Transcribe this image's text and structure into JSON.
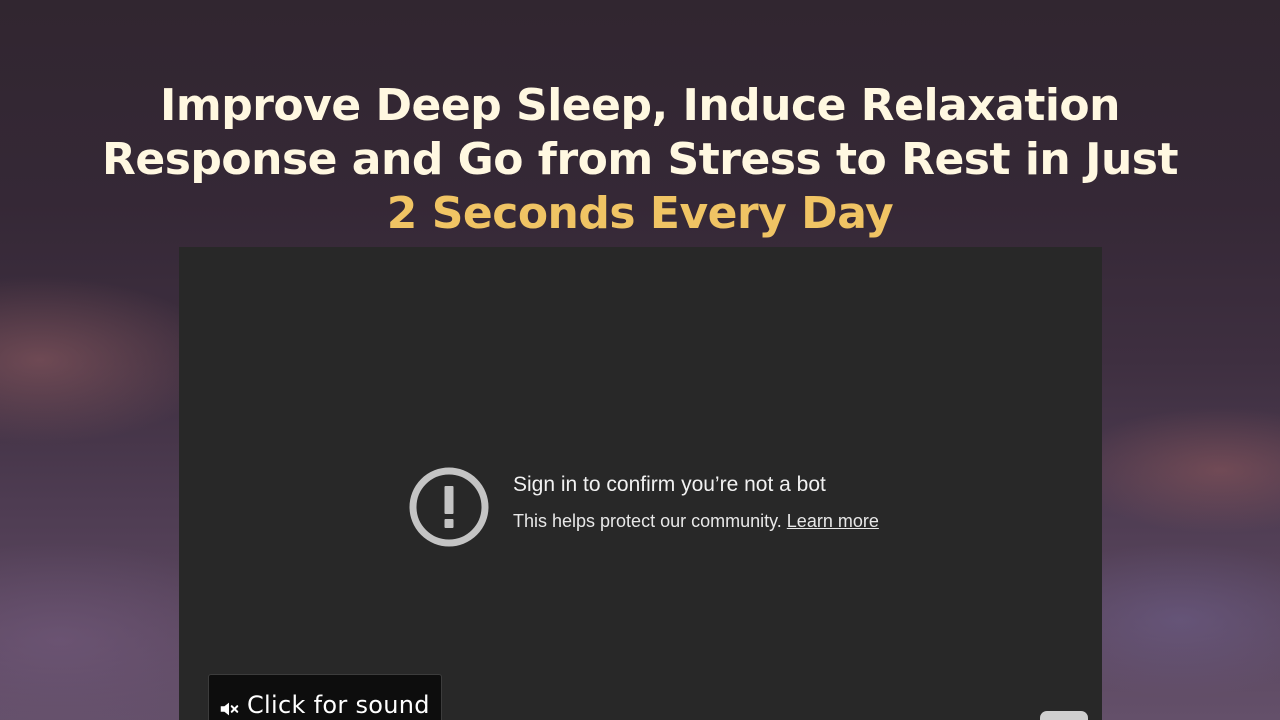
{
  "headline": {
    "line1": "Improve Deep Sleep, Induce Relaxation",
    "line2": "Response and Go from Stress to Rest in Just",
    "accent_line": "2 Seconds Every Day"
  },
  "video": {
    "error_title": "Sign in to confirm you’re not a bot",
    "error_subtitle": "This helps protect our community.",
    "learn_more_link": "Learn more",
    "sound_button_label": "Click for sound",
    "icons": {
      "alert": "alert-circle-icon",
      "mute": "speaker-muted-icon"
    }
  },
  "colors": {
    "headline": "#fff8e1",
    "accent": "#f0c464",
    "player_background": "#282828"
  }
}
